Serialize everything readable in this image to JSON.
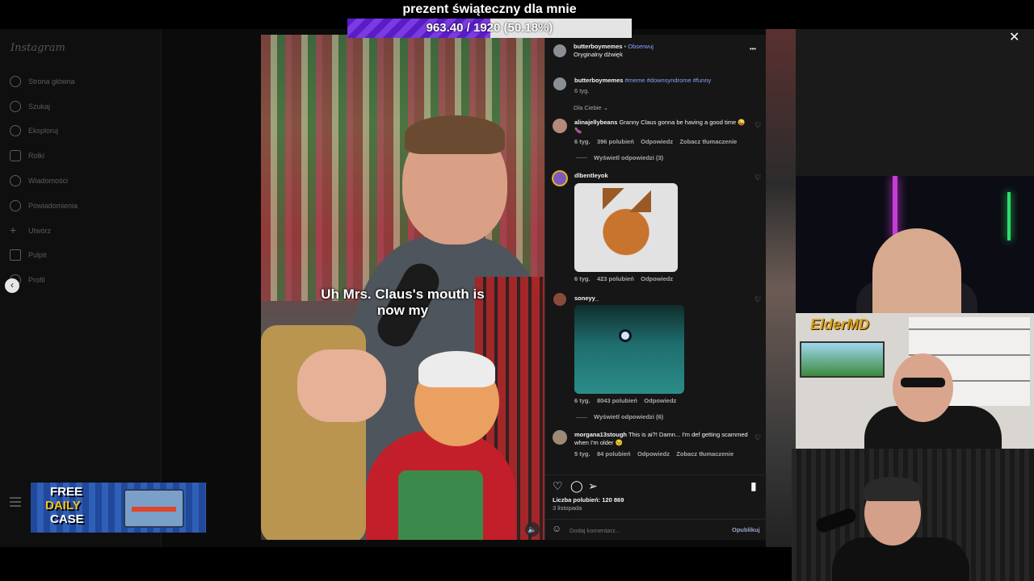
{
  "stream": {
    "goal_title": "prezent świąteczny dla mnie",
    "goal_progress_text": "963.40 / 1920 (50.18%)",
    "goal_fraction": 0.5018
  },
  "instagram": {
    "logo": "Instagram",
    "nav": [
      {
        "label": "Strona główna",
        "icon": "home-icon"
      },
      {
        "label": "Szukaj",
        "icon": "search-icon"
      },
      {
        "label": "Eksploruj",
        "icon": "explore-icon"
      },
      {
        "label": "Rolki",
        "icon": "reels-icon"
      },
      {
        "label": "Wiadomości",
        "icon": "messages-icon"
      },
      {
        "label": "Powiadomienia",
        "icon": "heart-icon"
      },
      {
        "label": "Utwórz",
        "icon": "plus-icon"
      },
      {
        "label": "Pulpit",
        "icon": "dashboard-icon"
      },
      {
        "label": "Profil",
        "icon": "profile-icon"
      }
    ]
  },
  "video": {
    "caption_line1": "Uh Mrs. Claus's mouth is",
    "caption_line2": "now my"
  },
  "post": {
    "author": "butterboymemes",
    "follow_label": "Obserwuj",
    "audio": "Oryginalny dźwięk",
    "more": "•••",
    "desc_author": "butterboymemes",
    "desc_tags": "#meme #downsyndrome #funny",
    "desc_time": "6 tyg.",
    "sort_label": "Dla Ciebie",
    "likes": "Liczba polubień: 120 869",
    "date": "3 listopada",
    "add_comment_placeholder": "Dodaj komentarz...",
    "publish_label": "Opublikuj"
  },
  "comments": {
    "c1": {
      "user": "alinajellybeans",
      "text": "Granny Claus gonna be having a good time 😜",
      "text2": "🍆",
      "time": "6 tyg.",
      "likes": "396 polubień",
      "reply": "Odpowiedz",
      "translate": "Zobacz tłumaczenie",
      "replies": "Wyświetl odpowiedzi (3)"
    },
    "c2": {
      "user": "dlbentleyok",
      "time": "6 tyg.",
      "likes": "423 polubień",
      "reply": "Odpowiedz"
    },
    "c3": {
      "user": "soneyy_",
      "time": "6 tyg.",
      "likes": "8043 polubień",
      "reply": "Odpowiedz",
      "replies": "Wyświetl odpowiedzi (6)"
    },
    "c4": {
      "user": "morgana13stough",
      "text": "This is ai?! Damn... I'm def getting scammed",
      "text2": "when I'm older 😣",
      "time": "5 tyg.",
      "likes": "84 polubień",
      "reply": "Odpowiedz",
      "translate": "Zobacz tłumaczenie"
    }
  },
  "overlay": {
    "elder_logo": "ElderMD",
    "promo_line1": "FREE",
    "promo_line2": "DAILY",
    "promo_line3": "CASE"
  }
}
